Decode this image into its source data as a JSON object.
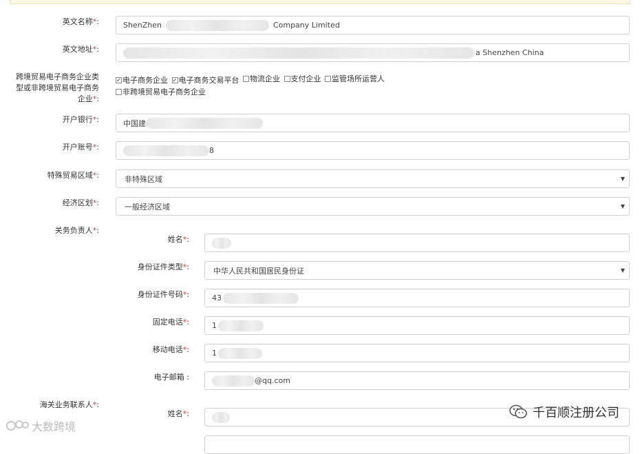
{
  "fields": {
    "en_name": {
      "label": "英文名称",
      "req": "*",
      "colon": ":",
      "prefix": "ShenZhen",
      "suffix": "Company Limited"
    },
    "en_address": {
      "label": "英文地址",
      "req": "*",
      "colon": ":",
      "suffix": "a Shenzhen China"
    },
    "enterprise_type": {
      "label_line1": "跨境贸易电子商务企业类",
      "label_line2": "型或非跨境贸易电子商务",
      "label_line3": "企业",
      "req": "*",
      "colon": ":",
      "options": [
        {
          "label": "电子商务企业",
          "checked": true
        },
        {
          "label": "电子商务交易平台",
          "checked": true
        },
        {
          "label": "物流企业",
          "checked": false
        },
        {
          "label": "支付企业",
          "checked": false
        },
        {
          "label": "监管场所运营人",
          "checked": false
        },
        {
          "label": "非跨境贸易电子商务企业",
          "checked": false
        }
      ]
    },
    "bank": {
      "label": "开户银行",
      "req": "*",
      "colon": ":",
      "prefix": "中国建"
    },
    "account": {
      "label": "开户账号",
      "req": "*",
      "colon": ":",
      "suffix": "8"
    },
    "special_zone": {
      "label": "特殊贸易区域",
      "req": "*",
      "colon": ":",
      "value": "非特殊区域"
    },
    "economic_zone": {
      "label": "经济区划",
      "req": "*",
      "colon": ":",
      "value": "一般经济区域"
    },
    "customs_head": {
      "label": "关务负责人",
      "req": "*",
      "colon": ":"
    },
    "head_name": {
      "label": "姓名",
      "req": "*",
      "colon": ":"
    },
    "head_id_type": {
      "label": "身份证件类型",
      "req": "*",
      "colon": ":",
      "value": "中华人民共和国居民身份证"
    },
    "head_id_no": {
      "label": "身份证件号码",
      "req": "*",
      "colon": ":",
      "prefix": "43"
    },
    "head_phone": {
      "label": "固定电话",
      "req": "*",
      "colon": ":",
      "prefix": "1"
    },
    "head_mobile": {
      "label": "移动电话",
      "req": "*",
      "colon": ":",
      "prefix": "1"
    },
    "head_email": {
      "label": "电子邮箱",
      "colon": ":",
      "suffix": "@qq.com"
    },
    "customs_contact": {
      "label": "海关业务联系人",
      "req": "*",
      "colon": ":"
    },
    "contact_name": {
      "label": "姓名",
      "req": "*",
      "colon": ":"
    }
  },
  "watermarks": {
    "right": "千百顺注册公司",
    "left": "大数跨境"
  },
  "caret": "▼"
}
